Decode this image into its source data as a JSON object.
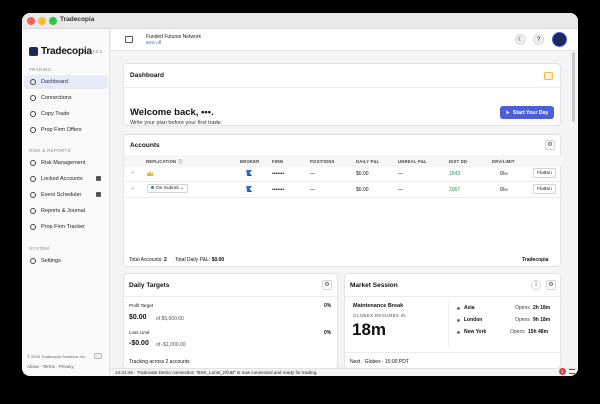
{
  "window": {
    "title": "Tradecopia"
  },
  "sidebar": {
    "brand": "Tradecopia",
    "version": "v2.0.1",
    "sections": [
      {
        "title": "TRADING",
        "items": [
          {
            "label": "Dashboard",
            "icon": "dashboard-icon",
            "active": true
          },
          {
            "label": "Connections",
            "icon": "link-icon"
          },
          {
            "label": "Copy Trade",
            "icon": "copy-icon"
          },
          {
            "label": "Prop Firm Offers",
            "icon": "tag-icon"
          }
        ]
      },
      {
        "title": "RISK & REPORTS",
        "items": [
          {
            "label": "Risk Management",
            "icon": "shield-icon"
          },
          {
            "label": "Locked Accounts",
            "icon": "lock-icon",
            "locked": true
          },
          {
            "label": "Event Scheduler",
            "icon": "calendar-icon",
            "locked": true
          },
          {
            "label": "Reports & Journal",
            "icon": "report-icon"
          },
          {
            "label": "Prop Firm Tracker",
            "icon": "chart-icon"
          }
        ]
      },
      {
        "title": "SYSTEM",
        "items": [
          {
            "label": "Settings",
            "icon": "gear-icon"
          }
        ]
      }
    ],
    "footer": "© 2026 Tradecopia Solutions Inc.",
    "links": "About · Terms · Privacy"
  },
  "topbar": {
    "network_title": "Funded Futures Network",
    "network_sub": "50% off",
    "theme_icon": "moon-icon",
    "help_icon": "help-icon"
  },
  "dashboard": {
    "title": "Dashboard",
    "welcome": "Welcome back, •••.",
    "subtitle": "Write your plan before your first trade.",
    "start_button": "Start Your Day"
  },
  "accounts": {
    "title": "Accounts",
    "columns": [
      "REPLICATION",
      "BROKER",
      "FIRM",
      "POSITIONS",
      "DAILY P&L",
      "UNREAL P&L",
      "DIST DD",
      "DRV/LIMIT"
    ],
    "rows": [
      {
        "replication": "",
        "firm": "•••••••",
        "positions": "—",
        "daily": "$0.00",
        "unreal": "—",
        "dist": "1843",
        "limit": "0/∞",
        "action": "Flatten"
      },
      {
        "replication": "On Submit",
        "firm": "•••••••",
        "positions": "—",
        "daily": "$0.00",
        "unreal": "—",
        "dist": "2067",
        "limit": "0/∞",
        "action": "Flatten"
      }
    ],
    "total_accounts_label": "Total Accounts:",
    "total_accounts": "2",
    "total_pnl_label": "Total Daily P&L:",
    "total_pnl": "$0.00",
    "footer_brand": "Tradecopia"
  },
  "daily_targets": {
    "title": "Daily Targets",
    "profit_label": "Profit Target",
    "profit_pct": "0%",
    "profit_value": "$0.00",
    "profit_of": "of $5,000.00",
    "loss_label": "Loss Limit",
    "loss_pct": "0%",
    "loss_value": "-$0.00",
    "loss_of": "of -$1,000.00",
    "footer": "Tracking across 2 accounts"
  },
  "market": {
    "title": "Market Session",
    "status": "Maintenance Break",
    "resume_label": "GLOBEX RESUMES IN",
    "countdown": "18m",
    "sessions": [
      {
        "name": "Asia",
        "opens": "Opens",
        "time": "2h 18m"
      },
      {
        "name": "London",
        "opens": "Opens",
        "time": "9h 18m"
      },
      {
        "name": "New York",
        "opens": "Opens",
        "time": "15h 48m"
      }
    ],
    "next": "Next · Globex · 15:00 PDT"
  },
  "status": {
    "message": "14:41:46 · Tradovate Demo connection \"BSK_Lonis_zrfUB\" is now connected and ready for trading.",
    "error_count": "1"
  }
}
